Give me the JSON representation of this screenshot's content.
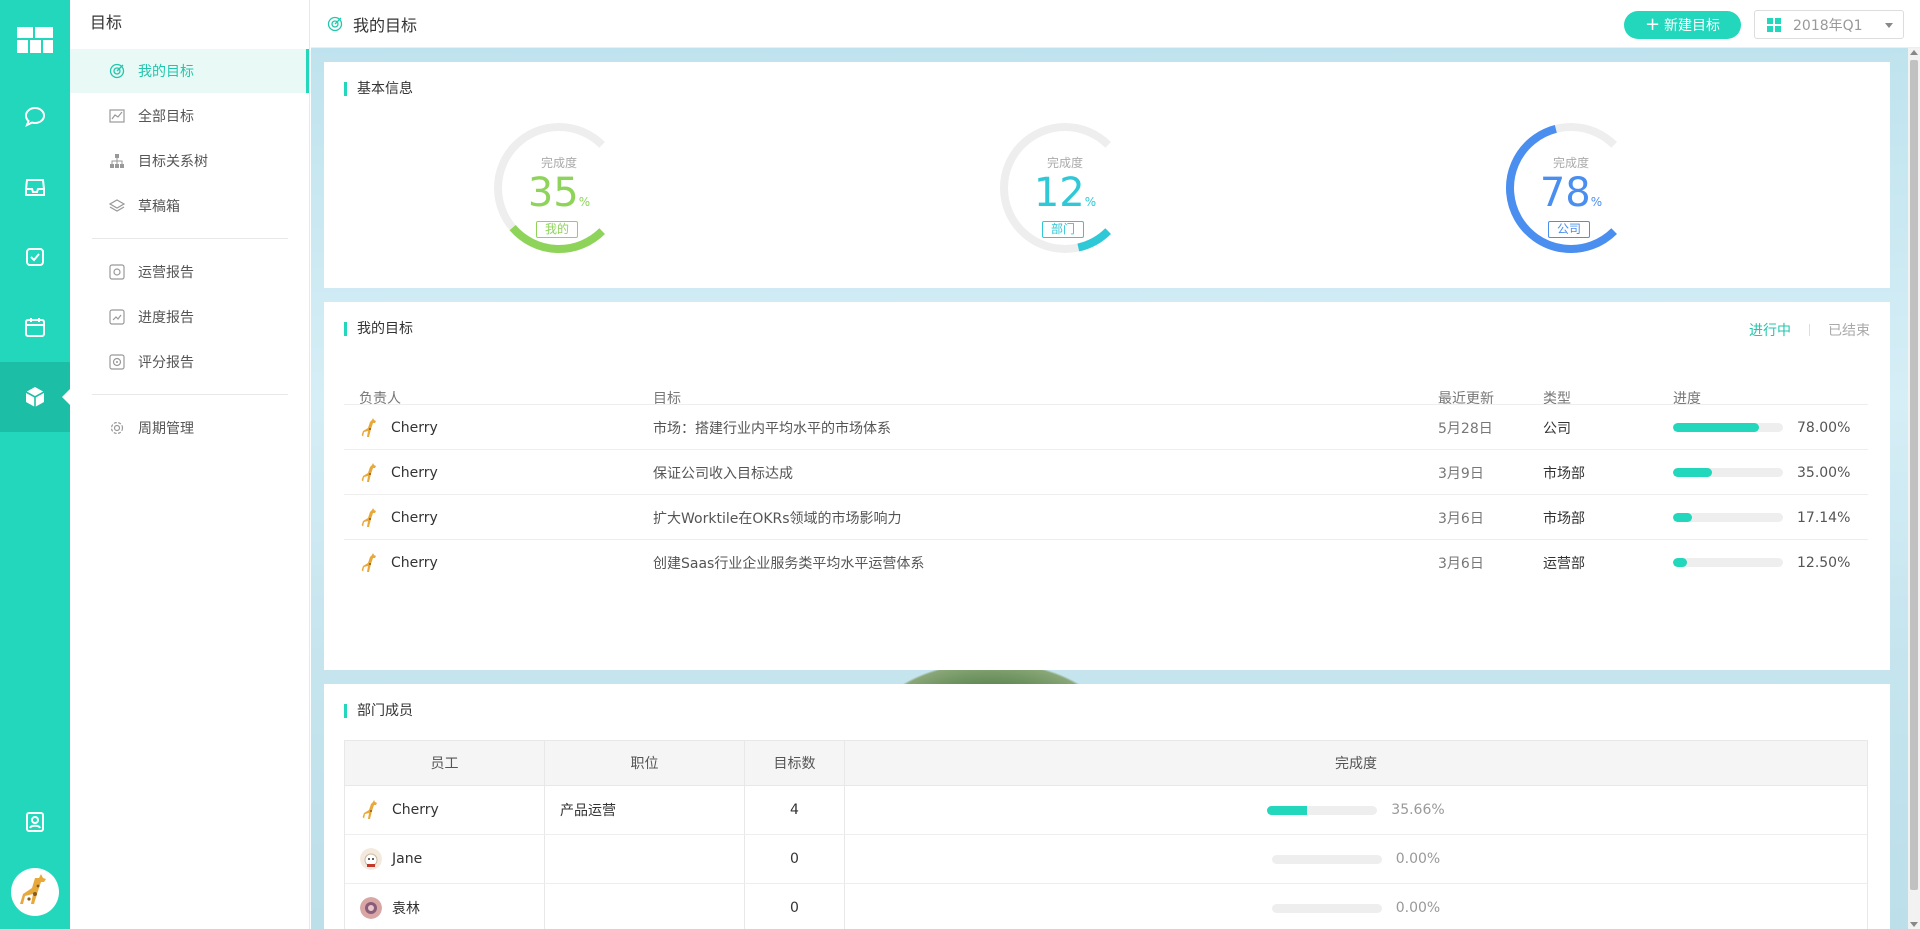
{
  "app": {
    "section_title": "目标"
  },
  "rail": {
    "icons": [
      "dashboard-icon",
      "chat-icon",
      "inbox-icon",
      "task-icon",
      "calendar-icon",
      "okr-cube-icon",
      "contacts-icon"
    ],
    "accent": "#22d7bb"
  },
  "sidebar": {
    "items": [
      {
        "label": "我的目标",
        "icon": "target-icon",
        "active": true
      },
      {
        "label": "全部目标",
        "icon": "chart-icon"
      },
      {
        "label": "目标关系树",
        "icon": "tree-icon"
      },
      {
        "label": "草稿箱",
        "icon": "layers-icon"
      },
      {
        "label": "运营报告",
        "icon": "report-icon"
      },
      {
        "label": "进度报告",
        "icon": "progress-report-icon"
      },
      {
        "label": "评分报告",
        "icon": "score-report-icon"
      },
      {
        "label": "周期管理",
        "icon": "gear-icon"
      }
    ]
  },
  "topbar": {
    "title": "我的目标",
    "new_button": "新建目标",
    "period": "2018年Q1"
  },
  "basic_info": {
    "title": "基本信息",
    "donuts": [
      {
        "caption": "完成度",
        "value": "35",
        "unit": "%",
        "tag": "我的",
        "percent": 35,
        "color": "#8fd45a"
      },
      {
        "caption": "完成度",
        "value": "12",
        "unit": "%",
        "tag": "部门",
        "percent": 12,
        "color": "#2ec8d6"
      },
      {
        "caption": "完成度",
        "value": "78",
        "unit": "%",
        "tag": "公司",
        "percent": 78,
        "color": "#4a8ef0"
      }
    ]
  },
  "my_goals": {
    "title": "我的目标",
    "tab_active": "进行中",
    "tab_inactive": "已结束",
    "headers": {
      "owner": "负责人",
      "goal": "目标",
      "updated": "最近更新",
      "type": "类型",
      "progress": "进度"
    },
    "rows": [
      {
        "owner": "Cherry",
        "goal": "市场：搭建行业内平均水平的市场体系",
        "updated": "5月28日",
        "type": "公司",
        "progress": "78.00%",
        "fraction": 0.78
      },
      {
        "owner": "Cherry",
        "goal": "保证公司收入目标达成",
        "updated": "3月9日",
        "type": "市场部",
        "progress": "35.00%",
        "fraction": 0.35
      },
      {
        "owner": "Cherry",
        "goal": "扩大Worktile在OKRs领域的市场影响力",
        "updated": "3月6日",
        "type": "市场部",
        "progress": "17.14%",
        "fraction": 0.1714
      },
      {
        "owner": "Cherry",
        "goal": "创建Saas行业企业服务类平均水平运营体系",
        "updated": "3月6日",
        "type": "运营部",
        "progress": "12.50%",
        "fraction": 0.125
      }
    ]
  },
  "members": {
    "title": "部门成员",
    "headers": {
      "employee": "员工",
      "position": "职位",
      "goal_count": "目标数",
      "completion": "完成度"
    },
    "rows": [
      {
        "name": "Cherry",
        "position": "产品运营",
        "count": "4",
        "completion": "35.66%",
        "fraction": 0.3566,
        "avatar": "giraffe-avatar"
      },
      {
        "name": "Jane",
        "position": "",
        "count": "0",
        "completion": "0.00%",
        "fraction": 0,
        "avatar": "dog-avatar"
      },
      {
        "name": "袁林",
        "position": "",
        "count": "0",
        "completion": "0.00%",
        "fraction": 0,
        "avatar": "photo-avatar"
      }
    ]
  }
}
